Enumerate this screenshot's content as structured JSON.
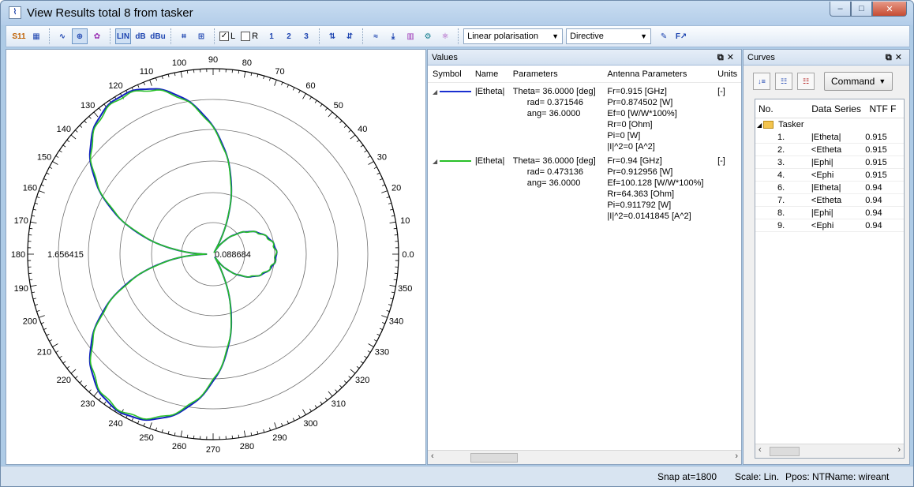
{
  "window": {
    "title": "View Results total 8 from tasker",
    "title_icon": "plot-app-icon",
    "controls": {
      "minimize": "–",
      "maximize": "□",
      "close": "✕"
    }
  },
  "toolbar": {
    "buttons1": [
      "S11",
      "grid"
    ],
    "buttons2": [
      "polar",
      "smith",
      "3d"
    ],
    "scale_buttons": [
      "LIN",
      "dB",
      "dBu"
    ],
    "marker_buttons": [
      "M",
      "M2"
    ],
    "check_L": {
      "label": "L",
      "checked": true
    },
    "check_R": {
      "label": "R",
      "checked": false
    },
    "number_buttons": [
      "1",
      "2",
      "3"
    ],
    "polarisation": {
      "value": "Linear polarisation"
    },
    "mode": {
      "value": "Directive"
    }
  },
  "plot": {
    "max_label": "1.656415",
    "center_label": "0.088684",
    "angle_labels": [
      "0.0",
      "10",
      "20",
      "30",
      "40",
      "50",
      "60",
      "70",
      "80",
      "90",
      "100",
      "110",
      "120",
      "130",
      "140",
      "150",
      "160",
      "170",
      "180",
      "190",
      "200",
      "210",
      "220",
      "230",
      "240",
      "250",
      "260",
      "270",
      "280",
      "290",
      "300",
      "310",
      "320",
      "330",
      "340",
      "350"
    ],
    "series_colors": {
      "blue": "#1020c0",
      "green": "#28c028"
    }
  },
  "values_panel": {
    "title": "Values",
    "headers": {
      "symbol": "Symbol",
      "name": "Name",
      "parameters": "Parameters",
      "antenna": "Antenna Parameters",
      "units": "Units"
    },
    "rows": [
      {
        "color": "#1a2fd0",
        "name": "|Etheta|",
        "params": [
          "Theta= 36.0000 [deg]",
          "rad= 0.371546",
          "ang= 36.0000"
        ],
        "antenna": [
          "Fr=0.915 [GHz]",
          "Pr=0.874502 [W]",
          "Ef=0 [W/W*100%]",
          "Rr=0 [Ohm]",
          "Pi=0 [W]",
          "|I|^2=0 [A^2]"
        ],
        "units": "[-]"
      },
      {
        "color": "#28c028",
        "name": "|Etheta|",
        "params": [
          "Theta= 36.0000 [deg]",
          "rad= 0.473136",
          "ang= 36.0000"
        ],
        "antenna": [
          "Fr=0.94 [GHz]",
          "Pr=0.912956 [W]",
          "Ef=100.128 [W/W*100%]",
          "Rr=64.363 [Ohm]",
          "Pi=0.911792 [W]",
          "|I|^2=0.0141845 [A^2]"
        ],
        "units": "[-]"
      }
    ]
  },
  "curves_panel": {
    "title": "Curves",
    "command_label": "Command",
    "headers": {
      "no": "No.",
      "series": "Data Series",
      "ntf": "NTF F"
    },
    "root": "Tasker",
    "rows": [
      {
        "no": "1.",
        "series": "|Etheta|",
        "ntf": "0.915"
      },
      {
        "no": "2.",
        "series": "<Etheta",
        "ntf": "0.915"
      },
      {
        "no": "3.",
        "series": "|Ephi|",
        "ntf": "0.915"
      },
      {
        "no": "4.",
        "series": "<Ephi",
        "ntf": "0.915"
      },
      {
        "no": "6.",
        "series": "|Etheta|",
        "ntf": "0.94"
      },
      {
        "no": "7.",
        "series": "<Etheta",
        "ntf": "0.94"
      },
      {
        "no": "8.",
        "series": "|Ephi|",
        "ntf": "0.94"
      },
      {
        "no": "9.",
        "series": "<Ephi",
        "ntf": "0.94"
      }
    ]
  },
  "status": {
    "snap": "Snap at=1800",
    "scale": "Scale: Lin.",
    "ppos": "Ppos: NTF",
    "name": "Name: wireant"
  }
}
